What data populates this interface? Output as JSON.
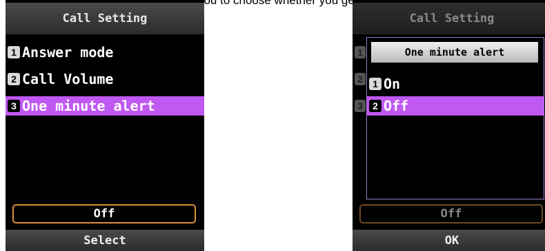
{
  "caption": "alert\" menu allows you to choose whether you get an alert minute.)",
  "left_screen": {
    "title": "Call Setting",
    "items": [
      {
        "num": "1",
        "label": "Answer mode"
      },
      {
        "num": "2",
        "label": "Call Volume"
      },
      {
        "num": "3",
        "label": "One minute alert"
      }
    ],
    "selected_index": 2,
    "current_value": "Off",
    "softkey": "Select"
  },
  "right_screen": {
    "title": "Call Setting",
    "ghost_nums": [
      "1",
      "2",
      "3"
    ],
    "popup": {
      "title": "One minute alert",
      "options": [
        {
          "num": "1",
          "label": "On"
        },
        {
          "num": "2",
          "label": "Off"
        }
      ],
      "selected_index": 1
    },
    "current_value": "Off",
    "softkey": "OK"
  },
  "colors": {
    "highlight": "#c058f2",
    "value_border": "#e0903a",
    "popup_border": "#a07ad0"
  }
}
